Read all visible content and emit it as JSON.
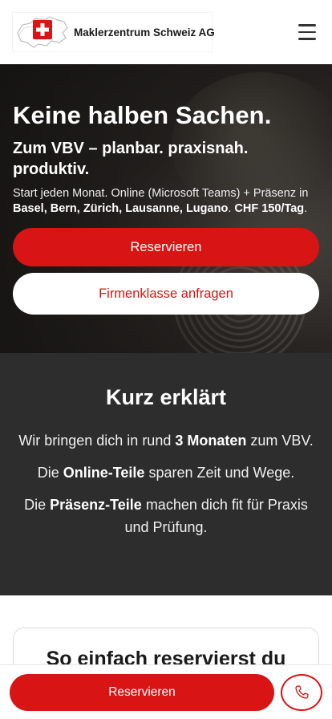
{
  "header": {
    "brand": "Maklerzentrum Schweiz AG",
    "menu_icon": "hamburger-menu-icon"
  },
  "hero": {
    "title": "Keine halben Sachen.",
    "subtitle": "Zum VBV – planbar. praxisnah. produktiv.",
    "text_intro": "Start jeden Monat. Online (Microsoft Teams) + Präsenz in ",
    "cities": "Basel, Bern, Zürich, Lausanne, Lugano",
    "sep": ". ",
    "price": "CHF 150/Tag",
    "end": ".",
    "primary_button": "Reservieren",
    "secondary_button": "Firmenklasse anfragen"
  },
  "kurz": {
    "title": "Kurz erklärt",
    "p1_a": "Wir bringen dich in rund ",
    "p1_b": "3 Monaten",
    "p1_c": " zum VBV.",
    "p2_a": "Die ",
    "p2_b": "Online-Teile",
    "p2_c": " sparen Zeit und Wege.",
    "p3_a": "Die ",
    "p3_b": "Präsenz-Teile",
    "p3_c": " machen dich fit für Praxis und Prüfung."
  },
  "card": {
    "title": "So einfach reservierst du"
  },
  "bottom_bar": {
    "button": "Reservieren",
    "phone_icon": "phone-icon"
  },
  "colors": {
    "accent": "#d91414",
    "dark_section": "#2d2d2d"
  }
}
